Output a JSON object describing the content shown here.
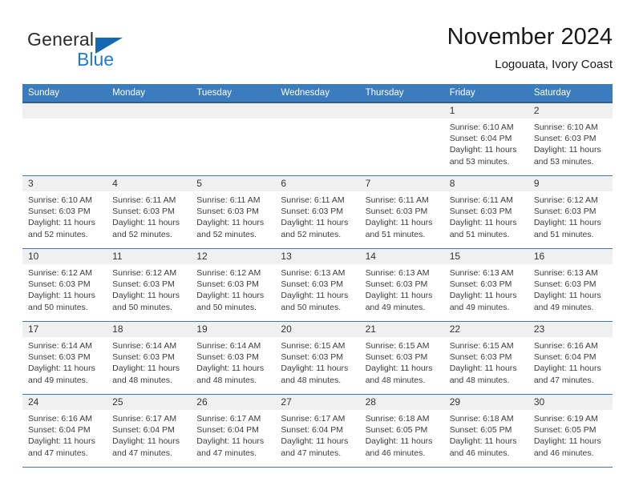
{
  "brand": {
    "name_part1": "General",
    "name_part2": "Blue",
    "logo_icon": "blue-triangle-icon"
  },
  "header": {
    "title": "November 2024",
    "subtitle": "Logouata, Ivory Coast"
  },
  "theme": {
    "header_bg": "#3a7cbe",
    "header_text": "#ffffff",
    "grid_line": "#3a7cbe",
    "daynum_bg": "#f0f0f0",
    "brand_blue": "#1f7cc4",
    "page_bg": "#ffffff"
  },
  "weekday_headers": [
    "Sunday",
    "Monday",
    "Tuesday",
    "Wednesday",
    "Thursday",
    "Friday",
    "Saturday"
  ],
  "labels": {
    "sunrise_prefix": "Sunrise:",
    "sunset_prefix": "Sunset:",
    "daylight_prefix": "Daylight:"
  },
  "weeks": [
    [
      {
        "day": "",
        "empty": true
      },
      {
        "day": "",
        "empty": true
      },
      {
        "day": "",
        "empty": true
      },
      {
        "day": "",
        "empty": true
      },
      {
        "day": "",
        "empty": true
      },
      {
        "day": "1",
        "sunrise": "Sunrise: 6:10 AM",
        "sunset": "Sunset: 6:04 PM",
        "daylight": "Daylight: 11 hours and 53 minutes."
      },
      {
        "day": "2",
        "sunrise": "Sunrise: 6:10 AM",
        "sunset": "Sunset: 6:03 PM",
        "daylight": "Daylight: 11 hours and 53 minutes."
      }
    ],
    [
      {
        "day": "3",
        "sunrise": "Sunrise: 6:10 AM",
        "sunset": "Sunset: 6:03 PM",
        "daylight": "Daylight: 11 hours and 52 minutes."
      },
      {
        "day": "4",
        "sunrise": "Sunrise: 6:11 AM",
        "sunset": "Sunset: 6:03 PM",
        "daylight": "Daylight: 11 hours and 52 minutes."
      },
      {
        "day": "5",
        "sunrise": "Sunrise: 6:11 AM",
        "sunset": "Sunset: 6:03 PM",
        "daylight": "Daylight: 11 hours and 52 minutes."
      },
      {
        "day": "6",
        "sunrise": "Sunrise: 6:11 AM",
        "sunset": "Sunset: 6:03 PM",
        "daylight": "Daylight: 11 hours and 52 minutes."
      },
      {
        "day": "7",
        "sunrise": "Sunrise: 6:11 AM",
        "sunset": "Sunset: 6:03 PM",
        "daylight": "Daylight: 11 hours and 51 minutes."
      },
      {
        "day": "8",
        "sunrise": "Sunrise: 6:11 AM",
        "sunset": "Sunset: 6:03 PM",
        "daylight": "Daylight: 11 hours and 51 minutes."
      },
      {
        "day": "9",
        "sunrise": "Sunrise: 6:12 AM",
        "sunset": "Sunset: 6:03 PM",
        "daylight": "Daylight: 11 hours and 51 minutes."
      }
    ],
    [
      {
        "day": "10",
        "sunrise": "Sunrise: 6:12 AM",
        "sunset": "Sunset: 6:03 PM",
        "daylight": "Daylight: 11 hours and 50 minutes."
      },
      {
        "day": "11",
        "sunrise": "Sunrise: 6:12 AM",
        "sunset": "Sunset: 6:03 PM",
        "daylight": "Daylight: 11 hours and 50 minutes."
      },
      {
        "day": "12",
        "sunrise": "Sunrise: 6:12 AM",
        "sunset": "Sunset: 6:03 PM",
        "daylight": "Daylight: 11 hours and 50 minutes."
      },
      {
        "day": "13",
        "sunrise": "Sunrise: 6:13 AM",
        "sunset": "Sunset: 6:03 PM",
        "daylight": "Daylight: 11 hours and 50 minutes."
      },
      {
        "day": "14",
        "sunrise": "Sunrise: 6:13 AM",
        "sunset": "Sunset: 6:03 PM",
        "daylight": "Daylight: 11 hours and 49 minutes."
      },
      {
        "day": "15",
        "sunrise": "Sunrise: 6:13 AM",
        "sunset": "Sunset: 6:03 PM",
        "daylight": "Daylight: 11 hours and 49 minutes."
      },
      {
        "day": "16",
        "sunrise": "Sunrise: 6:13 AM",
        "sunset": "Sunset: 6:03 PM",
        "daylight": "Daylight: 11 hours and 49 minutes."
      }
    ],
    [
      {
        "day": "17",
        "sunrise": "Sunrise: 6:14 AM",
        "sunset": "Sunset: 6:03 PM",
        "daylight": "Daylight: 11 hours and 49 minutes."
      },
      {
        "day": "18",
        "sunrise": "Sunrise: 6:14 AM",
        "sunset": "Sunset: 6:03 PM",
        "daylight": "Daylight: 11 hours and 48 minutes."
      },
      {
        "day": "19",
        "sunrise": "Sunrise: 6:14 AM",
        "sunset": "Sunset: 6:03 PM",
        "daylight": "Daylight: 11 hours and 48 minutes."
      },
      {
        "day": "20",
        "sunrise": "Sunrise: 6:15 AM",
        "sunset": "Sunset: 6:03 PM",
        "daylight": "Daylight: 11 hours and 48 minutes."
      },
      {
        "day": "21",
        "sunrise": "Sunrise: 6:15 AM",
        "sunset": "Sunset: 6:03 PM",
        "daylight": "Daylight: 11 hours and 48 minutes."
      },
      {
        "day": "22",
        "sunrise": "Sunrise: 6:15 AM",
        "sunset": "Sunset: 6:03 PM",
        "daylight": "Daylight: 11 hours and 48 minutes."
      },
      {
        "day": "23",
        "sunrise": "Sunrise: 6:16 AM",
        "sunset": "Sunset: 6:04 PM",
        "daylight": "Daylight: 11 hours and 47 minutes."
      }
    ],
    [
      {
        "day": "24",
        "sunrise": "Sunrise: 6:16 AM",
        "sunset": "Sunset: 6:04 PM",
        "daylight": "Daylight: 11 hours and 47 minutes."
      },
      {
        "day": "25",
        "sunrise": "Sunrise: 6:17 AM",
        "sunset": "Sunset: 6:04 PM",
        "daylight": "Daylight: 11 hours and 47 minutes."
      },
      {
        "day": "26",
        "sunrise": "Sunrise: 6:17 AM",
        "sunset": "Sunset: 6:04 PM",
        "daylight": "Daylight: 11 hours and 47 minutes."
      },
      {
        "day": "27",
        "sunrise": "Sunrise: 6:17 AM",
        "sunset": "Sunset: 6:04 PM",
        "daylight": "Daylight: 11 hours and 47 minutes."
      },
      {
        "day": "28",
        "sunrise": "Sunrise: 6:18 AM",
        "sunset": "Sunset: 6:05 PM",
        "daylight": "Daylight: 11 hours and 46 minutes."
      },
      {
        "day": "29",
        "sunrise": "Sunrise: 6:18 AM",
        "sunset": "Sunset: 6:05 PM",
        "daylight": "Daylight: 11 hours and 46 minutes."
      },
      {
        "day": "30",
        "sunrise": "Sunrise: 6:19 AM",
        "sunset": "Sunset: 6:05 PM",
        "daylight": "Daylight: 11 hours and 46 minutes."
      }
    ]
  ]
}
